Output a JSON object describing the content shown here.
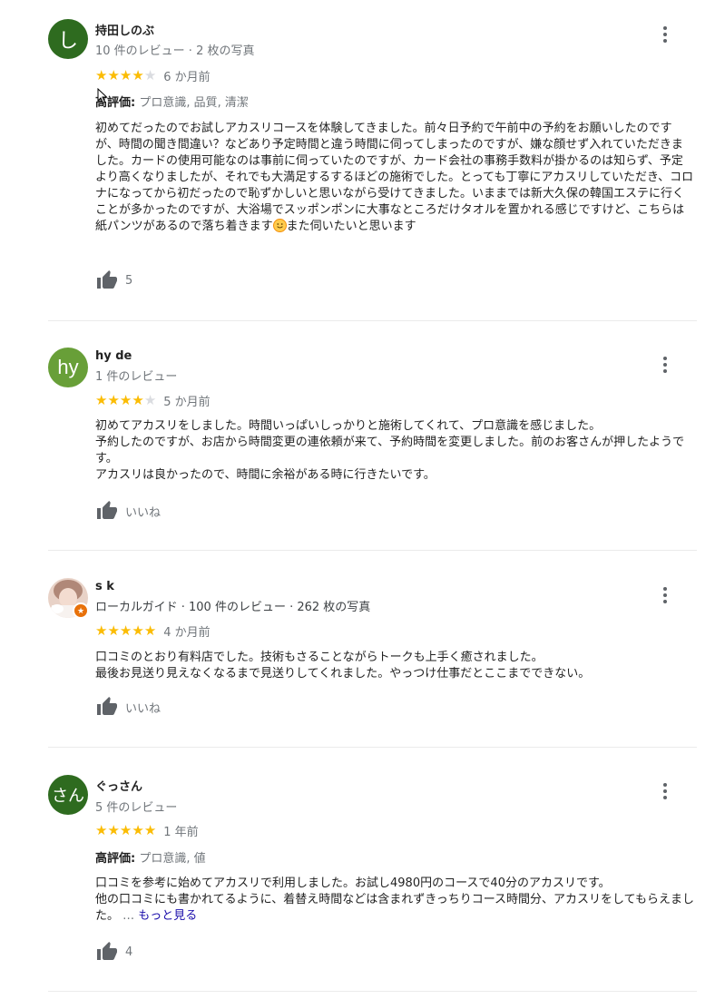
{
  "colors": {
    "star_filled": "#fbbc04",
    "star_empty": "#dadce0",
    "avatar_green_dark": "#2e6b1f",
    "avatar_green_light": "#689f38",
    "link": "#1a0dab",
    "local_guide_badge": "#e8710a"
  },
  "reviews": [
    {
      "name": "持田しのぶ",
      "avatar_text": "し",
      "meta": "10 件のレビュー · 2 枚の写真",
      "rating": 4,
      "time": "6 か月前",
      "highlights_label": "高評価:",
      "highlights_value": " プロ意識, 品質, 清潔",
      "text_main": "初めてだったのでお試しアカスリコースを体験してきました。前々日予約で午前中の予約をお願いしたのですが、時間の聞き間違い？などあり予定時間と違う時間に伺ってしまったのですが、嫌な顔せず入れていただきました。カードの使用可能なのは事前に伺っていたのですが、カード会社の事務手数料が掛かるのは知らず、予定より高くなりましたが、それでも大満足するするほどの施術でした。とっても丁寧にアカスリしていただき、コロナになってから初だったので恥ずかしいと思いながら受けてきました。いままでは新大久保の韓国エステに行くことが多かったのですが、大浴場でスッポンポンに大事なところだけタオルを置かれる感じですけど、こちらは紙パンツがあるので落ち着きます",
      "text_tail": "また伺いたいと思います",
      "likes": "5"
    },
    {
      "name": "hy de",
      "avatar_text": "hy",
      "meta": "1 件のレビュー",
      "rating": 4,
      "time": "5 か月前",
      "text": "初めてアカスリをしました。時間いっぱいしっかりと施術してくれて、プロ意識を感じました。\n予約したのですが、お店から時間変更の連依頼が来て、予約時間を変更しました。前のお客さんが押したようです。\nアカスリは良かったので、時間に余裕がある時に行きたいです。",
      "likes": "いいね"
    },
    {
      "name": "s k",
      "meta": "ローカルガイド · 100 件のレビュー · 262 枚の写真",
      "rating": 5,
      "time": "4 か月前",
      "text": "口コミのとおり有料店でした。技術もさることながらトークも上手く癒されました。\n最後お見送り見えなくなるまで見送りしてくれました。やっつけ仕事だとここまでできない。",
      "likes": "いいね"
    },
    {
      "name": "ぐっさん",
      "avatar_text": "さん",
      "meta": "5 件のレビュー",
      "rating": 5,
      "time": "1 年前",
      "highlights_label": "高評価:",
      "highlights_value": " プロ意識, 値",
      "text": "口コミを参考に始めてアカスリで利用しました。お試し4980円のコースで40分のアカスリです。\n他の口コミにも書かれてるように、着替え時間などは含まれずきっちりコース時間分、アカスリをしてもらえました。",
      "ellipsis": " … ",
      "more": "もっと見る",
      "likes": "4"
    }
  ]
}
